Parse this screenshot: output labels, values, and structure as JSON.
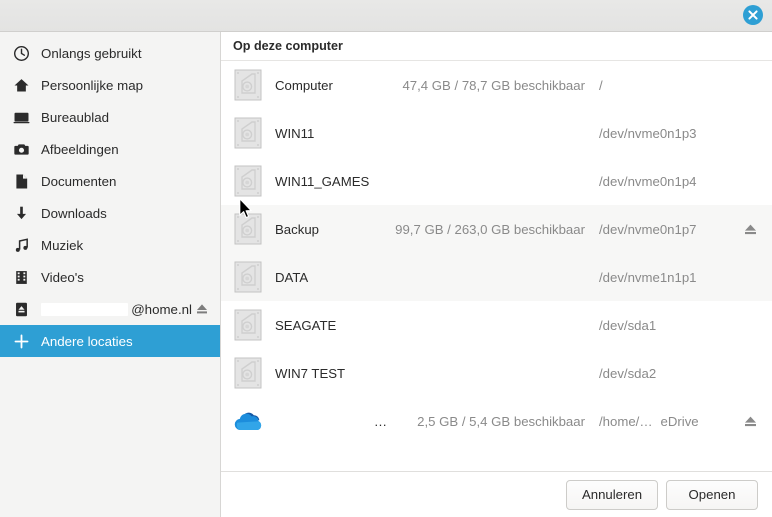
{
  "window": {
    "title": "",
    "close_icon": "close-icon"
  },
  "sidebar": {
    "items": [
      {
        "label": "Onlangs gebruikt",
        "icon": "clock-icon",
        "selected": false,
        "eject": false,
        "redacted": false
      },
      {
        "label": "Persoonlijke map",
        "icon": "home-icon",
        "selected": false,
        "eject": false,
        "redacted": false
      },
      {
        "label": "Bureaublad",
        "icon": "desktop-icon",
        "selected": false,
        "eject": false,
        "redacted": false
      },
      {
        "label": "Afbeeldingen",
        "icon": "camera-icon",
        "selected": false,
        "eject": false,
        "redacted": false
      },
      {
        "label": "Documenten",
        "icon": "document-icon",
        "selected": false,
        "eject": false,
        "redacted": false
      },
      {
        "label": "Downloads",
        "icon": "download-icon",
        "selected": false,
        "eject": false,
        "redacted": false
      },
      {
        "label": "Muziek",
        "icon": "music-icon",
        "selected": false,
        "eject": false,
        "redacted": false
      },
      {
        "label": "Video's",
        "icon": "film-icon",
        "selected": false,
        "eject": false,
        "redacted": false
      },
      {
        "label": "@home.nl",
        "icon": "drive-eject-icon",
        "selected": false,
        "eject": true,
        "redacted": true
      },
      {
        "label": "Andere locaties",
        "icon": "plus-icon",
        "selected": true,
        "eject": false,
        "redacted": false
      }
    ]
  },
  "main": {
    "section_title": "Op deze computer",
    "rows": [
      {
        "name": "Computer",
        "free": "47,4 GB / 78,7 GB beschikbaar",
        "path": "/",
        "extra": "",
        "icon": "hard-disk-icon",
        "eject": false,
        "tinted": false
      },
      {
        "name": "WIN11",
        "free": "",
        "path": "/dev/nvme0n1p3",
        "extra": "",
        "icon": "hard-disk-icon",
        "eject": false,
        "tinted": false
      },
      {
        "name": "WIN11_GAMES",
        "free": "",
        "path": "/dev/nvme0n1p4",
        "extra": "",
        "icon": "hard-disk-icon",
        "eject": false,
        "tinted": false
      },
      {
        "name": "Backup",
        "free": "99,7 GB / 263,0 GB beschikbaar",
        "path": "/dev/nvme0n1p7",
        "extra": "",
        "icon": "hard-disk-icon",
        "eject": true,
        "tinted": true
      },
      {
        "name": "DATA",
        "free": "",
        "path": "/dev/nvme1n1p1",
        "extra": "",
        "icon": "hard-disk-icon",
        "eject": false,
        "tinted": true
      },
      {
        "name": "SEAGATE",
        "free": "",
        "path": "/dev/sda1",
        "extra": "",
        "icon": "hard-disk-icon",
        "eject": false,
        "tinted": false
      },
      {
        "name": "WIN7 TEST",
        "free": "",
        "path": "/dev/sda2",
        "extra": "",
        "icon": "hard-disk-icon",
        "eject": false,
        "tinted": false
      },
      {
        "name": "…",
        "free": "2,5 GB / 5,4 GB beschikbaar",
        "path": "/home/…",
        "extra": "eDrive",
        "icon": "onedrive-cloud-icon",
        "eject": true,
        "tinted": false
      }
    ]
  },
  "actions": {
    "cancel_label": "Annuleren",
    "open_label": "Openen"
  },
  "colors": {
    "accent": "#2e9fd4",
    "sidebar_bg": "#f4f4f3",
    "row_tint": "#f7f7f6",
    "text": "#2b2b2b",
    "muted_text": "#8a8a8a",
    "onedrive_blue": "#1a7fd4"
  }
}
